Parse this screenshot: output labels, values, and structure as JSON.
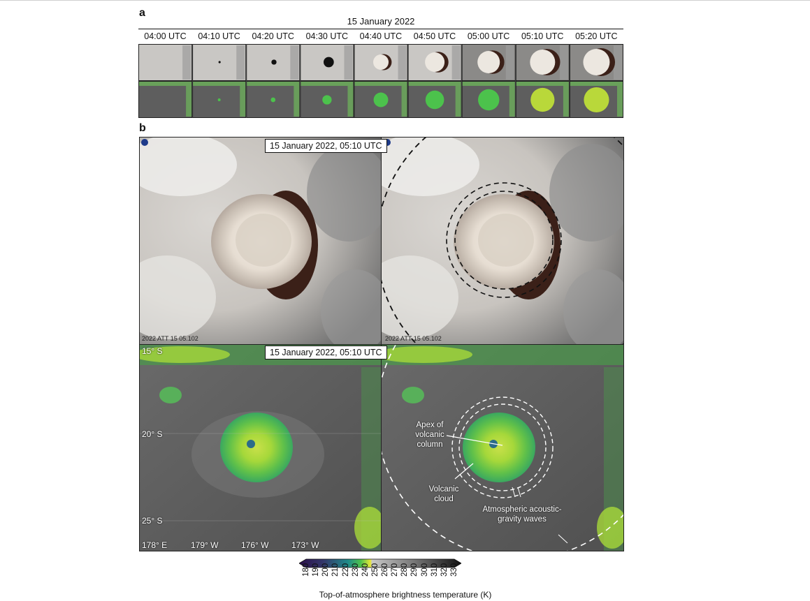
{
  "panels": {
    "a": "a",
    "b": "b"
  },
  "header": {
    "date": "15 January 2022"
  },
  "times": [
    "04:00 UTC",
    "04:10 UTC",
    "04:20 UTC",
    "04:30 UTC",
    "04:40 UTC",
    "04:50 UTC",
    "05:00 UTC",
    "05:10 UTC",
    "05:20 UTC"
  ],
  "timestamps": {
    "vis": "15 January 2022, 05:10 UTC",
    "ir": "15 January 2022, 05:10 UTC"
  },
  "watermark": "2022 ATT 15 05.102",
  "latitudes": {
    "lat15": "15° S",
    "lat20": "20° S",
    "lat25": "25° S"
  },
  "longitudes": {
    "lon178e": "178° E",
    "lon179w": "179° W",
    "lon176w": "176° W",
    "lon173w": "173° W"
  },
  "annotations": {
    "apex": [
      "Apex of",
      "volcanic",
      "column"
    ],
    "cloud": [
      "Volcanic",
      "cloud"
    ],
    "waves": [
      "Atmospheric acoustic-",
      "gravity waves"
    ]
  },
  "colorbar": {
    "title": "Top-of-atmosphere brightness temperature (K)",
    "ticks": [
      "180",
      "190",
      "200",
      "210",
      "220",
      "230",
      "240",
      "250",
      "260",
      "270",
      "280",
      "290",
      "300",
      "310",
      "320",
      "330"
    ],
    "colors": {
      "cold": "#2a0f4a",
      "teal": "#1f8a8a",
      "green": "#4cc24c",
      "yellow": "#e8e838",
      "warm": "#9a9a9a",
      "hot": "#111111"
    }
  }
}
